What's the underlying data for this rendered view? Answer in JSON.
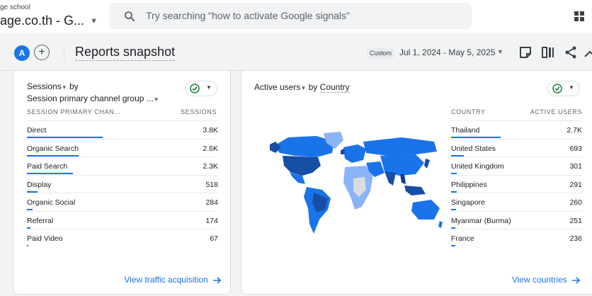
{
  "account": {
    "subtitle": "ge school",
    "name": "age.co.th - G..."
  },
  "search": {
    "placeholder": "Try searching \"how to activate Google signals\""
  },
  "toolbar": {
    "avatar_letter": "A",
    "add_label": "+",
    "page_title": "Reports snapshot",
    "date_badge": "Custom",
    "date_range": "Jul 1, 2024 - May 5, 2025"
  },
  "sessions_card": {
    "title_metric": "Sessions",
    "title_by": "by",
    "title_dimension": "Session primary channel group ...",
    "col_dimension": "SESSION PRIMARY CHAN...",
    "col_metric": "SESSIONS",
    "rows": [
      {
        "label": "Direct",
        "value": "3.8K",
        "share": 1.0
      },
      {
        "label": "Organic Search",
        "value": "2.6K",
        "share": 0.68
      },
      {
        "label": "Paid Search",
        "value": "2.3K",
        "share": 0.61
      },
      {
        "label": "Display",
        "value": "518",
        "share": 0.14
      },
      {
        "label": "Organic Social",
        "value": "284",
        "share": 0.075
      },
      {
        "label": "Referral",
        "value": "174",
        "share": 0.045
      },
      {
        "label": "Paid Video",
        "value": "67",
        "share": 0.018
      }
    ],
    "link": "View traffic acquisition"
  },
  "country_card": {
    "title_metric": "Active users",
    "title_by": "by",
    "title_dimension": "Country",
    "col_dimension": "COUNTRY",
    "col_metric": "ACTIVE USERS",
    "rows": [
      {
        "label": "Thailand",
        "value": "2.7K",
        "share": 1.0
      },
      {
        "label": "United States",
        "value": "693",
        "share": 0.26
      },
      {
        "label": "United Kingdom",
        "value": "301",
        "share": 0.11
      },
      {
        "label": "Philippines",
        "value": "291",
        "share": 0.11
      },
      {
        "label": "Singapore",
        "value": "260",
        "share": 0.1
      },
      {
        "label": "Myanmar (Burma)",
        "value": "251",
        "share": 0.09
      },
      {
        "label": "France",
        "value": "236",
        "share": 0.09
      }
    ],
    "link": "View countries"
  },
  "colors": {
    "accent": "#1a73e8",
    "map_dark": "#174ea6",
    "map_mid": "#1a73e8",
    "map_light": "#8ab4f8",
    "map_none": "#dadce0",
    "check_green": "#188038"
  },
  "icons": [
    "search-icon",
    "apps-grid-icon",
    "edit-note-icon",
    "compare-icon",
    "share-icon",
    "insights-icon",
    "check-circle-icon",
    "arrow-right-icon"
  ]
}
